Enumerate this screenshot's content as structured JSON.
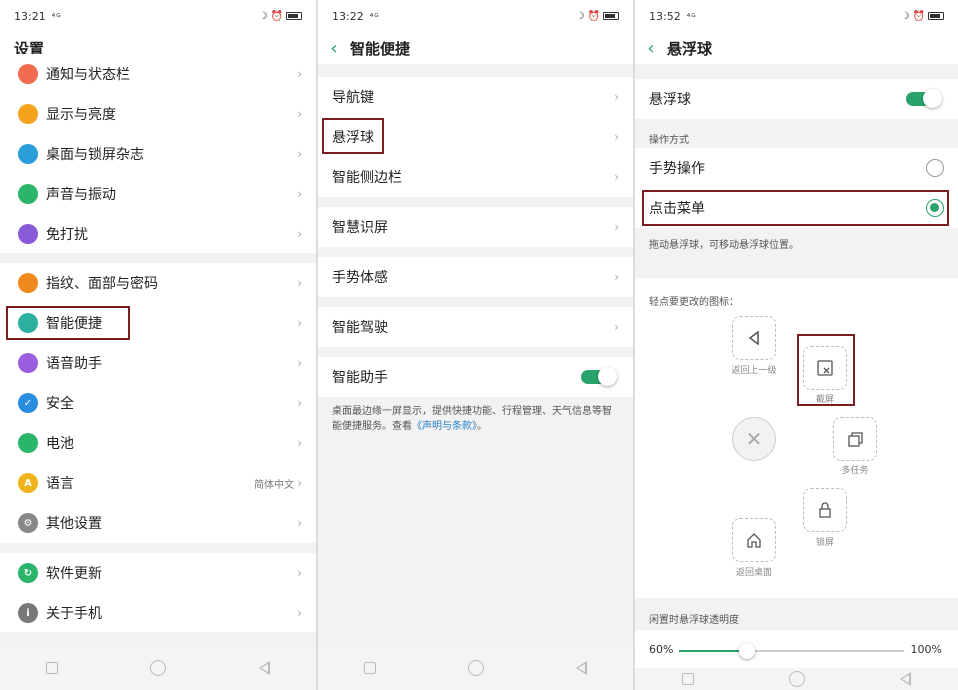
{
  "colors": {
    "accent": "#2aa36a",
    "highlight": "#7a1f1f"
  },
  "panel1": {
    "time": "13:21",
    "signal": "⁴ᴳ",
    "title": "设置",
    "items_a": [
      {
        "label": "通知与状态栏",
        "icon": "notification-icon",
        "color": "#f06b4f",
        "glyph": ""
      },
      {
        "label": "显示与亮度",
        "icon": "brightness-icon",
        "color": "#f2a21b",
        "glyph": ""
      },
      {
        "label": "桌面与锁屏杂志",
        "icon": "wallpaper-icon",
        "color": "#2a9ed8",
        "glyph": ""
      },
      {
        "label": "声音与振动",
        "icon": "speaker-icon",
        "color": "#2bb56a",
        "glyph": ""
      },
      {
        "label": "免打扰",
        "icon": "moon-icon",
        "color": "#8a5bd6",
        "glyph": ""
      }
    ],
    "items_b": [
      {
        "label": "指纹、面部与密码",
        "icon": "fingerprint-icon",
        "color": "#ef8a1c",
        "glyph": ""
      },
      {
        "label": "智能便捷",
        "icon": "smart-assist-icon",
        "color": "#2bb0a0",
        "glyph": ""
      },
      {
        "label": "语音助手",
        "icon": "microphone-icon",
        "color": "#9b5de0",
        "glyph": ""
      },
      {
        "label": "安全",
        "icon": "shield-icon",
        "color": "#2a8ee0",
        "glyph": "✓"
      },
      {
        "label": "电池",
        "icon": "battery-icon",
        "color": "#2bb56a",
        "glyph": ""
      },
      {
        "label": "语言",
        "icon": "language-icon",
        "color": "#f2b21b",
        "glyph": "A",
        "value": "简体中文"
      },
      {
        "label": "其他设置",
        "icon": "gear-icon",
        "color": "#888888",
        "glyph": "⚙"
      }
    ],
    "items_c": [
      {
        "label": "软件更新",
        "icon": "update-icon",
        "color": "#2bb56a",
        "glyph": "↻"
      },
      {
        "label": "关于手机",
        "icon": "info-icon",
        "color": "#777777",
        "glyph": "i"
      }
    ]
  },
  "panel2": {
    "time": "13:22",
    "signal": "⁴ᴳ",
    "title": "智能便捷",
    "items": [
      "导航键",
      "悬浮球",
      "智能侧边栏",
      "智慧识屏",
      "手势体感",
      "智能驾驶",
      "智能助手"
    ],
    "note": "桌面最边缘一屏显示，提供快捷功能、行程管理、天气信息等智能便捷服务。查看",
    "note_link": "《声明与条款》",
    "note_end": "。"
  },
  "panel3": {
    "time": "13:52",
    "signal": "⁴ᴳ",
    "title": "悬浮球",
    "toggle_label": "悬浮球",
    "mode_header": "操作方式",
    "mode_gesture": "手势操作",
    "mode_menu": "点击菜单",
    "drag_note": "拖动悬浮球，可移动悬浮球位置。",
    "icons_header": "轻点要更改的图标：",
    "icon_back": "返回上一级",
    "icon_screenshot": "截屏",
    "icon_multitask": "多任务",
    "icon_lock": "锁屏",
    "icon_home": "返回桌面",
    "opacity_header": "闲置时悬浮球透明度",
    "opacity_min": "60%",
    "opacity_max": "100%",
    "opacity_level": 0.3
  }
}
